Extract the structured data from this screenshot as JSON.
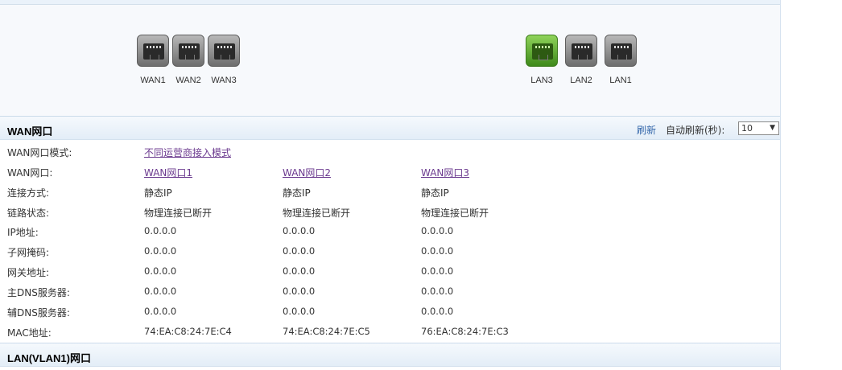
{
  "ports": {
    "wan": [
      {
        "label": "WAN1",
        "active": false
      },
      {
        "label": "WAN2",
        "active": false
      },
      {
        "label": "WAN3",
        "active": false
      }
    ],
    "lan": [
      {
        "label": "LAN3",
        "active": true
      },
      {
        "label": "LAN2",
        "active": false
      },
      {
        "label": "LAN1",
        "active": false
      }
    ]
  },
  "wan_section": {
    "title": "WAN网口",
    "refresh_label": "刷新",
    "auto_refresh_label": "自动刷新(秒):",
    "auto_refresh_value": "10",
    "mode_key": "WAN网口模式:",
    "mode_value": "不同运营商接入模式",
    "rows": [
      {
        "key": "WAN网口:",
        "values": [
          "WAN网口1",
          "WAN网口2",
          "WAN网口3"
        ],
        "link": true
      },
      {
        "key": "连接方式:",
        "values": [
          "静态IP",
          "静态IP",
          "静态IP"
        ]
      },
      {
        "key": "链路状态:",
        "values": [
          "物理连接已断开",
          "物理连接已断开",
          "物理连接已断开"
        ]
      },
      {
        "key": "IP地址:",
        "values": [
          "0.0.0.0",
          "0.0.0.0",
          "0.0.0.0"
        ]
      },
      {
        "key": "子网掩码:",
        "values": [
          "0.0.0.0",
          "0.0.0.0",
          "0.0.0.0"
        ]
      },
      {
        "key": "网关地址:",
        "values": [
          "0.0.0.0",
          "0.0.0.0",
          "0.0.0.0"
        ]
      },
      {
        "key": "主DNS服务器:",
        "values": [
          "0.0.0.0",
          "0.0.0.0",
          "0.0.0.0"
        ]
      },
      {
        "key": "辅DNS服务器:",
        "values": [
          "0.0.0.0",
          "0.0.0.0",
          "0.0.0.0"
        ]
      },
      {
        "key": "MAC地址:",
        "values": [
          "74:EA:C8:24:7E:C4",
          "74:EA:C8:24:7E:C5",
          "76:EA:C8:24:7E:C3"
        ]
      }
    ]
  },
  "lan_section": {
    "title": "LAN(VLAN1)网口"
  }
}
